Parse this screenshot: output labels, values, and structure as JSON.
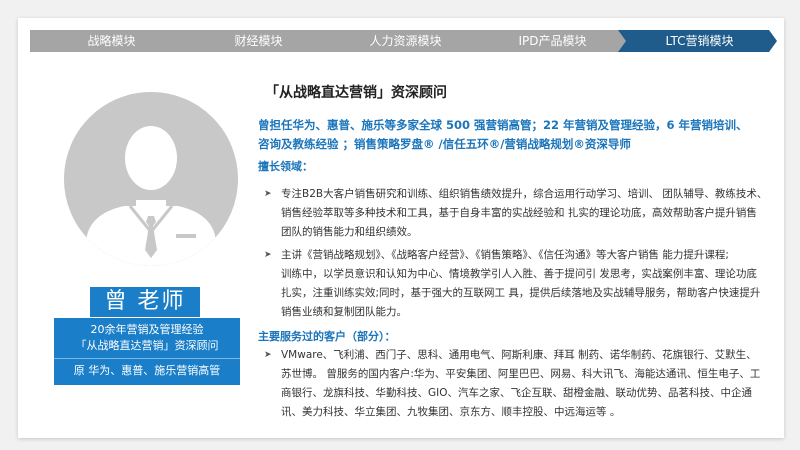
{
  "steps": [
    {
      "label": "战略模块",
      "active": false
    },
    {
      "label": "财经模块",
      "active": false
    },
    {
      "label": "人力资源模块",
      "active": false
    },
    {
      "label": "IPD产品模块",
      "active": false
    },
    {
      "label": "LTC营销模块",
      "active": true
    }
  ],
  "profile": {
    "name": "曾 老师",
    "info_line1": "20余年营销及管理经验",
    "info_line2": "「从战略直达营销」资深顾问",
    "info_line3": "原 华为、惠普、施乐营销高管"
  },
  "content": {
    "title": "「从战略直达营销」资深顾问",
    "headline_line1": "曾担任华为、惠普、施乐等多家全球 500 强营销高管；22 年营销及管理经验，6 年营销培训、",
    "headline_line2": "咨询及教练经验 ；销售策略罗盘® /信任五环®/营销战略规划®资深导师",
    "expertise_label": "擅长领域：",
    "bullet1": [
      "专注B2B大客户销售研究和训练、组织销售绩效提升，综合运用行动学习、培训、 团队辅导、教练技术、",
      "销售经验萃取等多种技术和工具，基于自身丰富的实战经验和 扎实的理论功底，高效帮助客户提升销售",
      "团队的销售能力和组织绩效。"
    ],
    "bullet2": [
      "主讲《营销战略规划》、《战略客户经营》、《销售策略》、《信任沟通》等大客户销售 能力提升课程;",
      "训练中，以学员意识和认知为中心、情境教学引人入胜、善于提问引 发思考，实战案例丰富、理论功底",
      "扎实，注重训练实效;同时，基于强大的互联网工 具，提供后续落地及实战辅导服务，帮助客户快速提升",
      "销售业绩和复制团队能力。"
    ],
    "clients_label": "主要服务过的客户（部分）：",
    "bullet3": [
      "VMware、飞利浦、西门子、思科、通用电气、阿斯利康、拜耳 制药、诺华制药、花旗银行、艾默生、",
      "苏世博。 曾服务的国内客户:华为、平安集团、阿里巴巴、网易、科大讯飞、海能达通讯、恒生电子、工",
      "商银行、龙旗科技、华勤科技、GIO、汽车之家、飞企互联、甜橙金融、联动优势、品茗科技、中企通",
      "讯、美力科技、华立集团、九牧集团、京东方、顺丰控股、中远海运等 。"
    ],
    "arrow_glyph": "➤"
  },
  "colors": {
    "accent_blue": "#1b7ec8",
    "headline_blue": "#1b75bb",
    "active_step": "#1f5c8b",
    "inactive_step": "#a5a5a5"
  }
}
